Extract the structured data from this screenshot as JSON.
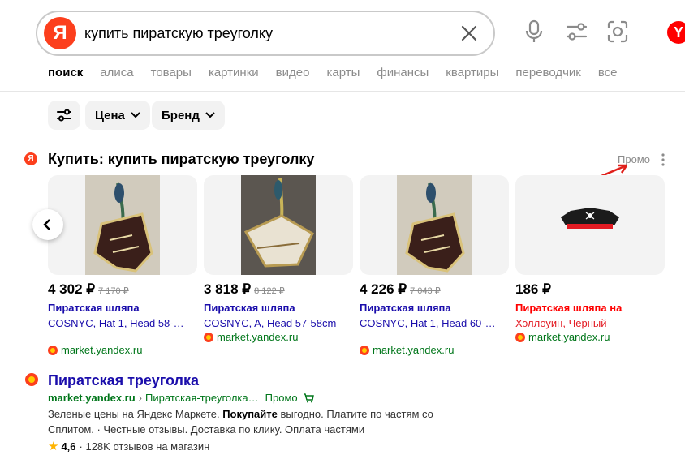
{
  "search": {
    "logo_letter": "Я",
    "query": "купить пиратскую треуголку"
  },
  "header": {
    "profile_letter": "Y"
  },
  "nav": {
    "items": [
      "поиск",
      "алиса",
      "товары",
      "картинки",
      "видео",
      "карты",
      "финансы",
      "квартиры",
      "переводчик",
      "все"
    ]
  },
  "filters": {
    "price_label": "Цена",
    "brand_label": "Бренд"
  },
  "promo": {
    "badge_letter": "Я",
    "title": "Купить: купить пиратскую треуголку",
    "tag": "Промо",
    "cards": [
      {
        "price": "4 302 ₽",
        "old_price": "7 170 ₽",
        "title": "Пиратская шляпа",
        "desc": "COSNYC, Hat 1, Head 58-…",
        "shop": "market.yandex.ru"
      },
      {
        "price": "3 818 ₽",
        "old_price": "8 122 ₽",
        "title": "Пиратская шляпа",
        "desc": "COSNYC, A, Head 57-58cm",
        "shop": "market.yandex.ru"
      },
      {
        "price": "4 226 ₽",
        "old_price": "7 043 ₽",
        "title": "Пиратская шляпа",
        "desc": "COSNYC, Hat 1, Head 60-…",
        "shop": "market.yandex.ru"
      },
      {
        "price": "186 ₽",
        "old_price": "",
        "title": "Пиратская шляпа",
        "title_suffix": " на",
        "desc": "Хэллоуин, Черный",
        "shop": "market.yandex.ru"
      }
    ]
  },
  "result": {
    "title": "Пиратская треуголка",
    "domain": "market.yandex.ru",
    "separator": "›",
    "path": "Пиратская-треуголка…",
    "promo_label": "Промо",
    "text_part1": "Зеленые цены на Яндекс Маркете. ",
    "text_bold": "Покупайте",
    "text_part2": " выгодно. Платите по частям со Сплитом. · Честные отзывы. Доставка по клику. Оплата частями",
    "rating_star": "★",
    "rating_score": "4,6",
    "rating_text": "· 128K отзывов на магазин"
  },
  "colors": {
    "brand": "#fc3f1d",
    "link": "#1a0dab",
    "url_green": "#00761a",
    "annotation_red": "#e0201b"
  }
}
